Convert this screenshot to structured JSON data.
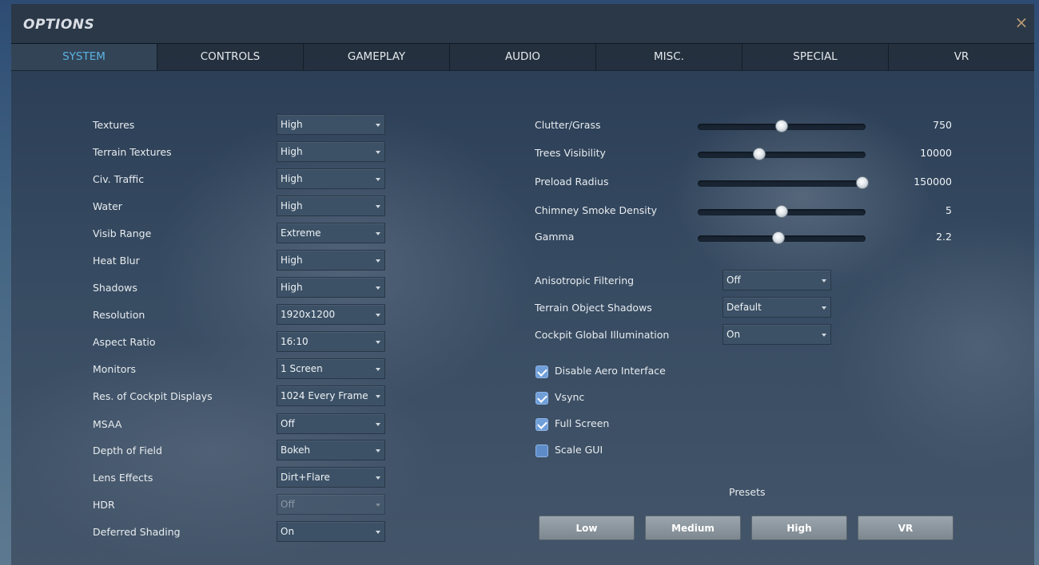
{
  "window": {
    "title": "OPTIONS",
    "close_glyph": "×"
  },
  "tabs": [
    {
      "label": "SYSTEM",
      "active": true
    },
    {
      "label": "CONTROLS"
    },
    {
      "label": "GAMEPLAY"
    },
    {
      "label": "AUDIO"
    },
    {
      "label": "MISC."
    },
    {
      "label": "SPECIAL"
    },
    {
      "label": "VR"
    }
  ],
  "left_settings": [
    {
      "label": "Textures",
      "value": "High"
    },
    {
      "label": "Terrain Textures",
      "value": "High"
    },
    {
      "label": "Civ. Traffic",
      "value": "High"
    },
    {
      "label": "Water",
      "value": "High"
    },
    {
      "label": "Visib Range",
      "value": "Extreme"
    },
    {
      "label": "Heat Blur",
      "value": "High"
    },
    {
      "label": "Shadows",
      "value": "High"
    },
    {
      "label": "Resolution",
      "value": "1920x1200"
    },
    {
      "label": "Aspect Ratio",
      "value": "16:10"
    },
    {
      "label": "Monitors",
      "value": "1 Screen"
    },
    {
      "label": "Res. of Cockpit Displays",
      "value": "1024 Every Frame"
    },
    {
      "label": "MSAA",
      "value": "Off"
    },
    {
      "label": "Depth of Field",
      "value": "Bokeh"
    },
    {
      "label": "Lens Effects",
      "value": "Dirt+Flare"
    },
    {
      "label": "HDR",
      "value": "Off",
      "disabled": true
    },
    {
      "label": "Deferred Shading",
      "value": "On"
    }
  ],
  "sliders": [
    {
      "label": "Clutter/Grass",
      "value": "750",
      "level": 0.5
    },
    {
      "label": "Trees Visibility",
      "value": "10000",
      "level": 0.365
    },
    {
      "label": "Preload Radius",
      "value": "150000",
      "level": 0.98
    },
    {
      "label": "Chimney Smoke Density",
      "value": "5",
      "level": 0.5
    },
    {
      "label": "Gamma",
      "value": "2.2",
      "level": 0.48
    }
  ],
  "right_settings": [
    {
      "label": "Anisotropic Filtering",
      "value": "Off"
    },
    {
      "label": "Terrain Object Shadows",
      "value": "Default"
    },
    {
      "label": "Cockpit Global Illumination",
      "value": "On"
    }
  ],
  "checkboxes": [
    {
      "label": "Disable Aero Interface",
      "checked": true
    },
    {
      "label": "Vsync",
      "checked": true
    },
    {
      "label": "Full Screen",
      "checked": true
    },
    {
      "label": "Scale GUI",
      "checked": false
    }
  ],
  "presets": {
    "label": "Presets",
    "buttons": [
      "Low",
      "Medium",
      "High",
      "VR"
    ]
  },
  "colors": {
    "active_tab": "#5bb3e2",
    "close": "#b99a72",
    "checkbox": "#6f9ed9"
  }
}
